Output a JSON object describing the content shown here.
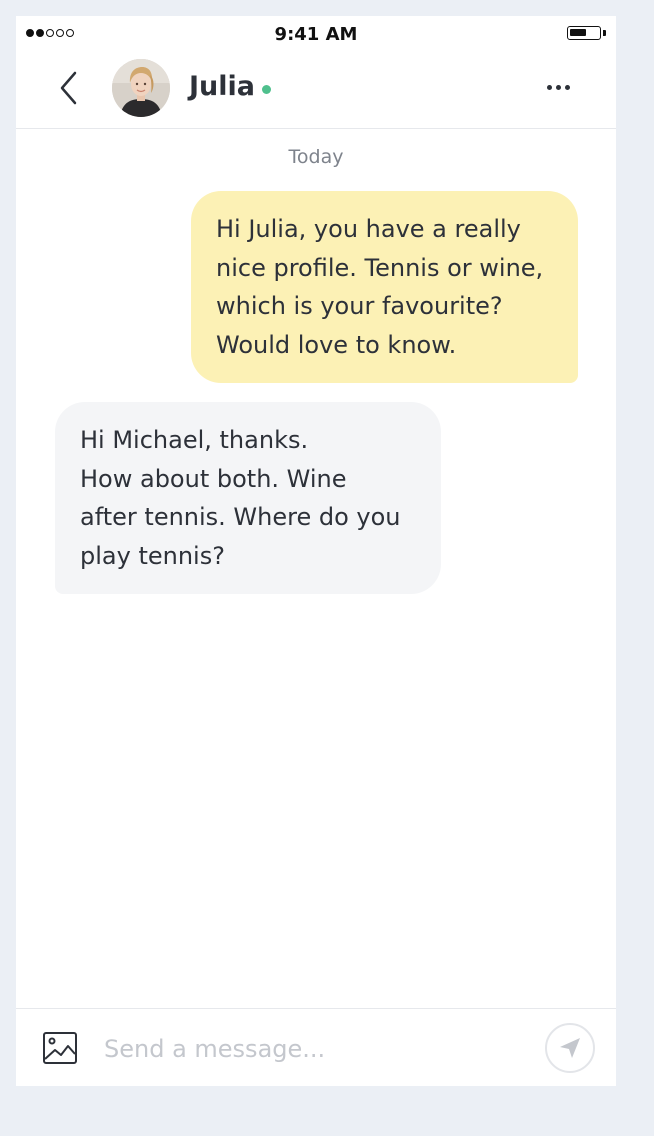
{
  "status_bar": {
    "time": "9:41 AM",
    "signal_bars_filled": 2,
    "signal_bars_total": 5,
    "battery_level": 0.6
  },
  "header": {
    "contact_name": "Julia",
    "online": true,
    "back_icon": "chevron-left-icon",
    "more_icon": "more-horizontal-icon",
    "online_color": "#4fc08d"
  },
  "conversation": {
    "date_label": "Today",
    "messages": [
      {
        "direction": "outgoing",
        "lines": [
          "Hi Julia, you have a really",
          "nice profile. Tennis or wine,",
          "which is your favourite?",
          "Would love to know."
        ],
        "bubble_color": "#fcf1b5"
      },
      {
        "direction": "incoming",
        "lines": [
          "Hi Michael, thanks.",
          "How about both. Wine",
          "after tennis. Where do you",
          "play tennis?"
        ],
        "bubble_color": "#f4f5f7"
      }
    ]
  },
  "composer": {
    "placeholder": "Send a message...",
    "value": "",
    "image_icon": "image-icon",
    "send_icon": "send-icon"
  }
}
